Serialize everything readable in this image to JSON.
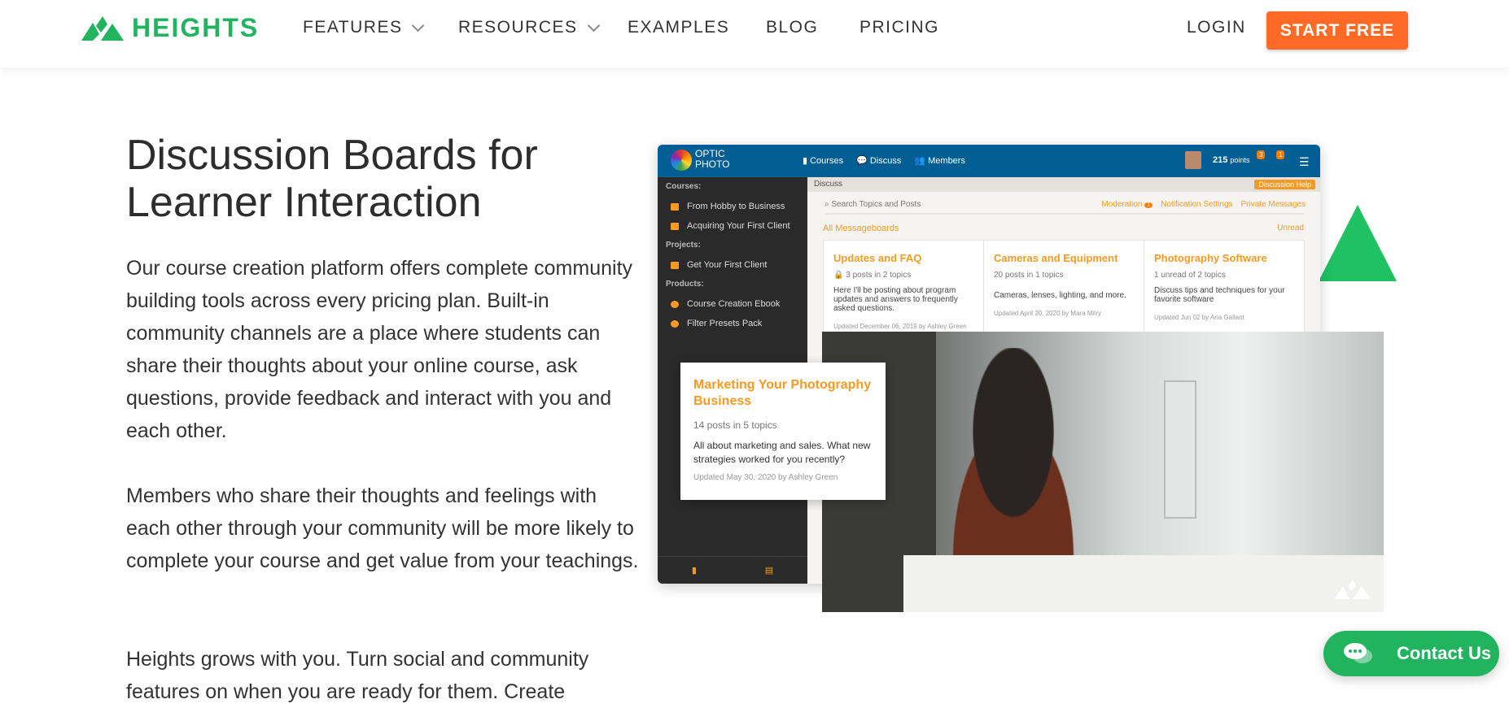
{
  "header": {
    "brand": "HEIGHTS",
    "nav": [
      "FEATURES",
      "RESOURCES",
      "EXAMPLES",
      "BLOG",
      "PRICING"
    ],
    "login": "LOGIN",
    "cta": "START FREE",
    "colors": {
      "brand": "#22b35e",
      "cta": "#ff6b26"
    }
  },
  "hero": {
    "title": "Discussion Boards for Learner Interaction",
    "paragraphs": [
      "Our course creation platform offers complete community building tools across every pricing plan. Built-in community channels are a place where students can share their thoughts about your online course, ask questions, provide feedback and interact with you and each other.",
      "Members who share their thoughts and feelings with each other through your community will be more likely to complete your course and get value from your teachings.",
      "Heights grows with you. Turn social and community features on when you are ready for them. Create"
    ]
  },
  "mockup": {
    "logo": [
      "OPTIC",
      "PHOTO"
    ],
    "nav": [
      "Courses",
      "Discuss",
      "Members"
    ],
    "points": "215",
    "points_label": "points",
    "notif_count": "3",
    "msg_count": "1",
    "breadcrumb": "Discuss",
    "help": "Discussion Help",
    "search_placeholder": "Search Topics and Posts",
    "links": [
      "Moderation",
      "Notification Settings",
      "Private Messages"
    ],
    "moderation_count": "1",
    "all_boards": "All Messageboards",
    "unread": "Unread",
    "sidebar": [
      {
        "label": "Courses:",
        "items": [
          "From Hobby to Business",
          "Acquiring Your First Client"
        ]
      },
      {
        "label": "Projects:",
        "items": [
          "Get Your First Client"
        ]
      },
      {
        "label": "Products:",
        "items": [
          "Course Creation Ebook",
          "Filter Presets Pack"
        ]
      }
    ],
    "boards": [
      {
        "title": "Updates and FAQ",
        "meta": "3 posts in 2 topics",
        "desc": "Here I'll be posting about program updates and answers to frequently asked questions.",
        "updated": "Updated December 06, 2019 by Ashley Green"
      },
      {
        "title": "Cameras and Equipment",
        "meta": "20 posts in 1 topics",
        "desc": "Cameras, lenses, lighting, and more.",
        "updated": "Updated April 20, 2020 by Mara Mitry"
      },
      {
        "title": "Photography Software",
        "meta": "1 unread of 2 topics",
        "desc": "Discuss tips and techniques for your favorite software",
        "updated": "Updated Jun 02 by Ana Gallant"
      }
    ],
    "featured": {
      "title": "Marketing Your Photography Business",
      "meta": "14 posts in 5 topics",
      "desc": "All about marketing and sales. What new strategies worked for you recently?",
      "updated": "Updated May 30, 2020 by Ashley Green"
    },
    "accent": "#f59a23",
    "topbar": "#005e94"
  },
  "contact": {
    "label": "Contact Us"
  }
}
